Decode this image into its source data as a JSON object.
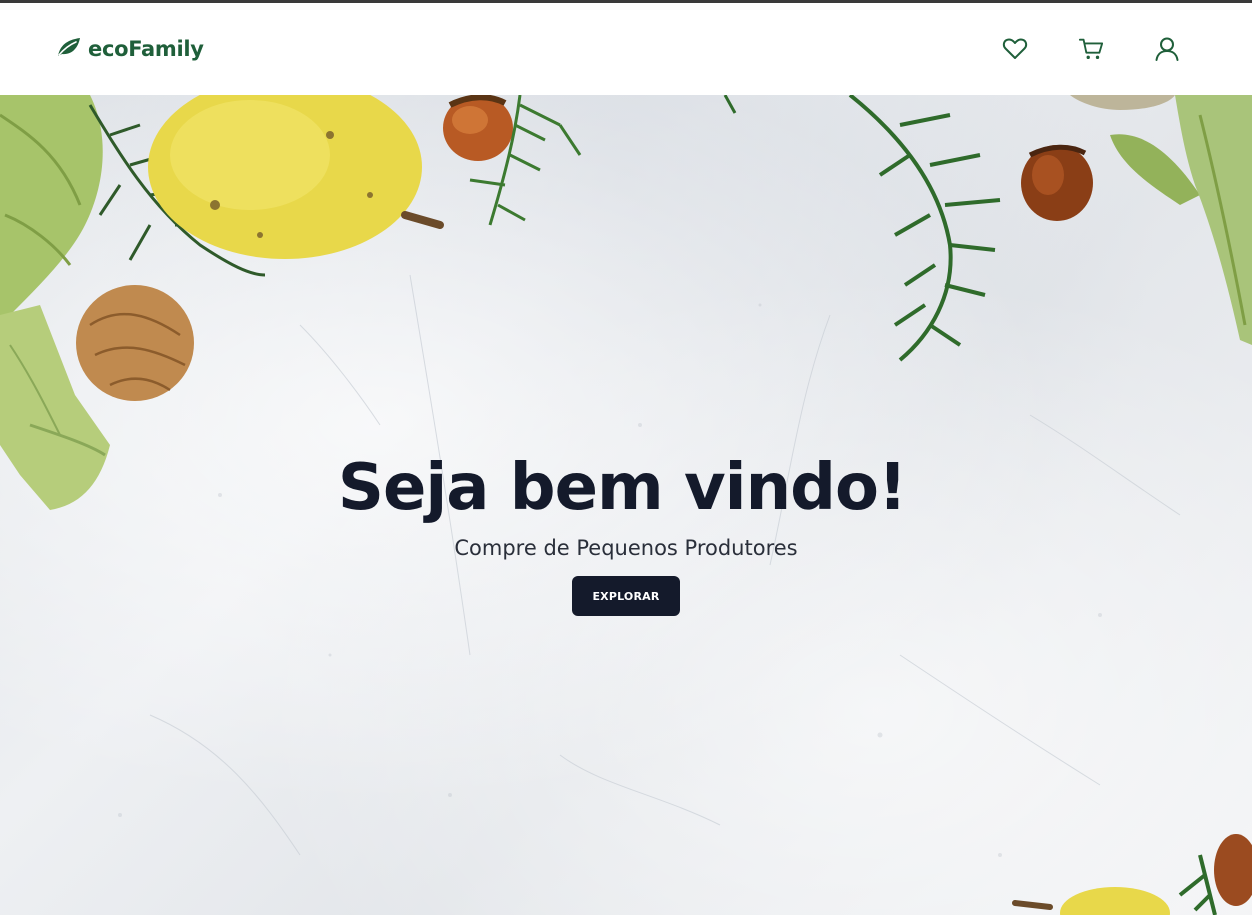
{
  "header": {
    "brand_name": "ecoFamily",
    "brand_icon": "leaf-icon",
    "brand_color": "#1f5f3a",
    "icons": [
      "heart-icon",
      "cart-icon",
      "user-icon"
    ]
  },
  "hero": {
    "title": "Seja bem vindo!",
    "subtitle": "Compre de Pequenos Produtores",
    "cta_label": "EXPLORAR",
    "background_image": "marble-surface-with-fruits-vegetables-nuts"
  },
  "colors": {
    "dark": "#141a2b",
    "accent_green": "#1f5f3a"
  }
}
